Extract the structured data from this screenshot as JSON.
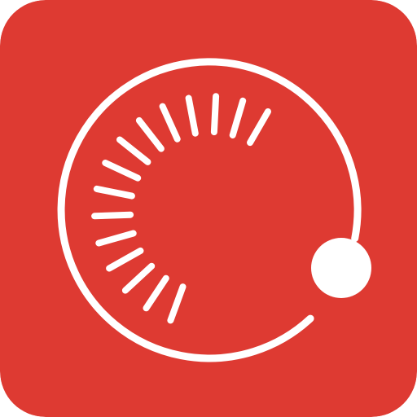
{
  "app_icon": {
    "icon": "exposure-dial-icon",
    "colors": {
      "background": "#de3a32",
      "foreground": "#ffffff"
    },
    "dial": {
      "tick_count": 15,
      "knob_icon": "dial-knob-icon"
    }
  }
}
